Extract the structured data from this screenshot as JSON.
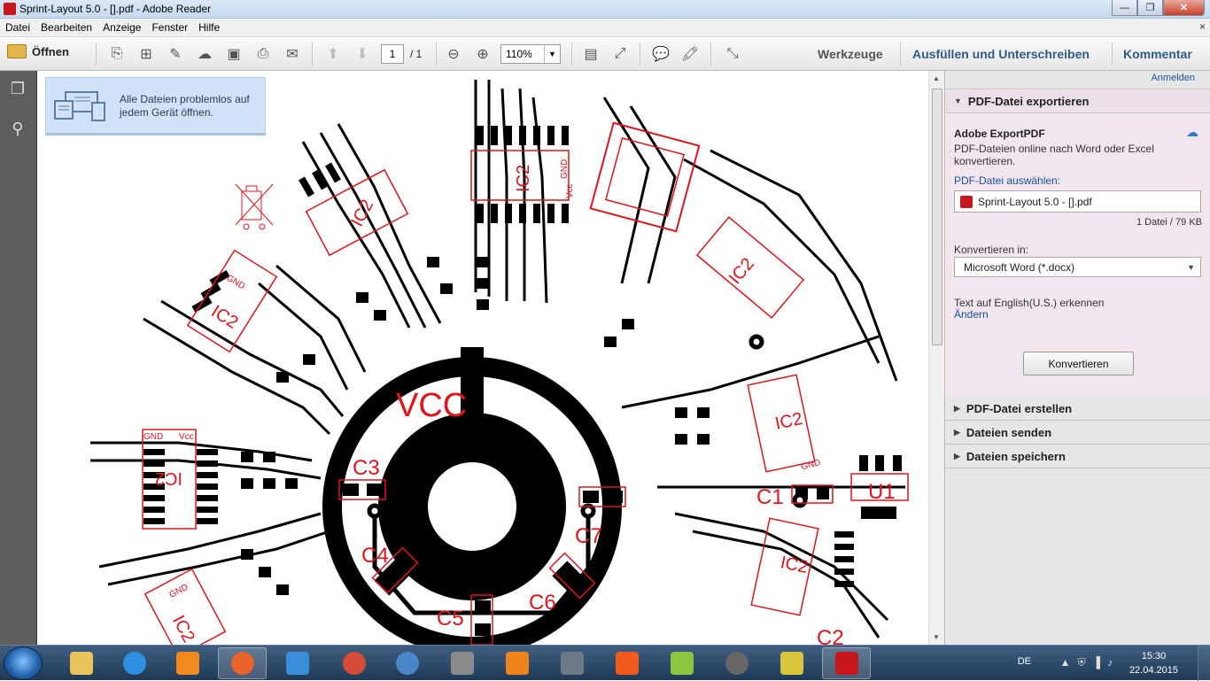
{
  "window": {
    "title": "Sprint-Layout 5.0 - [].pdf - Adobe Reader",
    "min": "—",
    "max": "❐",
    "close": "✕"
  },
  "menu": {
    "items": [
      "Datei",
      "Bearbeiten",
      "Anzeige",
      "Fenster",
      "Hilfe"
    ],
    "close": "×"
  },
  "toolbar": {
    "open_label": "Öffnen",
    "page_current": "1",
    "page_total": "/ 1",
    "zoom": "110%",
    "tools": "Werkzeuge",
    "fill_sign": "Ausfüllen und Unterschreiben",
    "comment": "Kommentar"
  },
  "promo": {
    "line1": "Alle Dateien problemlos auf",
    "line2": "jedem Gerät öffnen."
  },
  "pcb": {
    "vcc": "VCC",
    "labels": [
      "C1",
      "C3",
      "C4",
      "C5",
      "C6",
      "C7",
      "U1",
      "C2"
    ],
    "ic_label": "IC2",
    "gnd": "GND",
    "vcc_small": "Vcc"
  },
  "panel": {
    "login": "Anmelden",
    "export_title": "PDF-Datei exportieren",
    "service": "Adobe ExportPDF",
    "desc": "PDF-Dateien online nach Word oder Excel konvertieren.",
    "select_label": "PDF-Datei auswählen:",
    "file": "Sprint-Layout 5.0 - [].pdf",
    "count": "1 Datei / 79 KB",
    "convert_to": "Konvertieren in:",
    "format": "Microsoft Word (*.docx)",
    "lang_text": "Text auf English(U.S.) erkennen",
    "change": "Ändern",
    "convert_btn": "Konvertieren",
    "create": "PDF-Datei erstellen",
    "send": "Dateien senden",
    "save": "Dateien speichern"
  },
  "taskbar": {
    "lang": "DE",
    "time": "15:30",
    "date": "22.04.2015",
    "apps": [
      "explorer",
      "internet-explorer",
      "media-player",
      "firefox",
      "outlook",
      "app",
      "thunderbird",
      "usb",
      "vlc",
      "app2",
      "klipfolio",
      "app3",
      "app4",
      "bascom-avr",
      "adobe-reader"
    ]
  },
  "colors": {
    "pcb_copper": "#000000",
    "pcb_silk": "#e0141c",
    "panel_bg": "#f1e6ee",
    "link": "#1a4f9c"
  }
}
